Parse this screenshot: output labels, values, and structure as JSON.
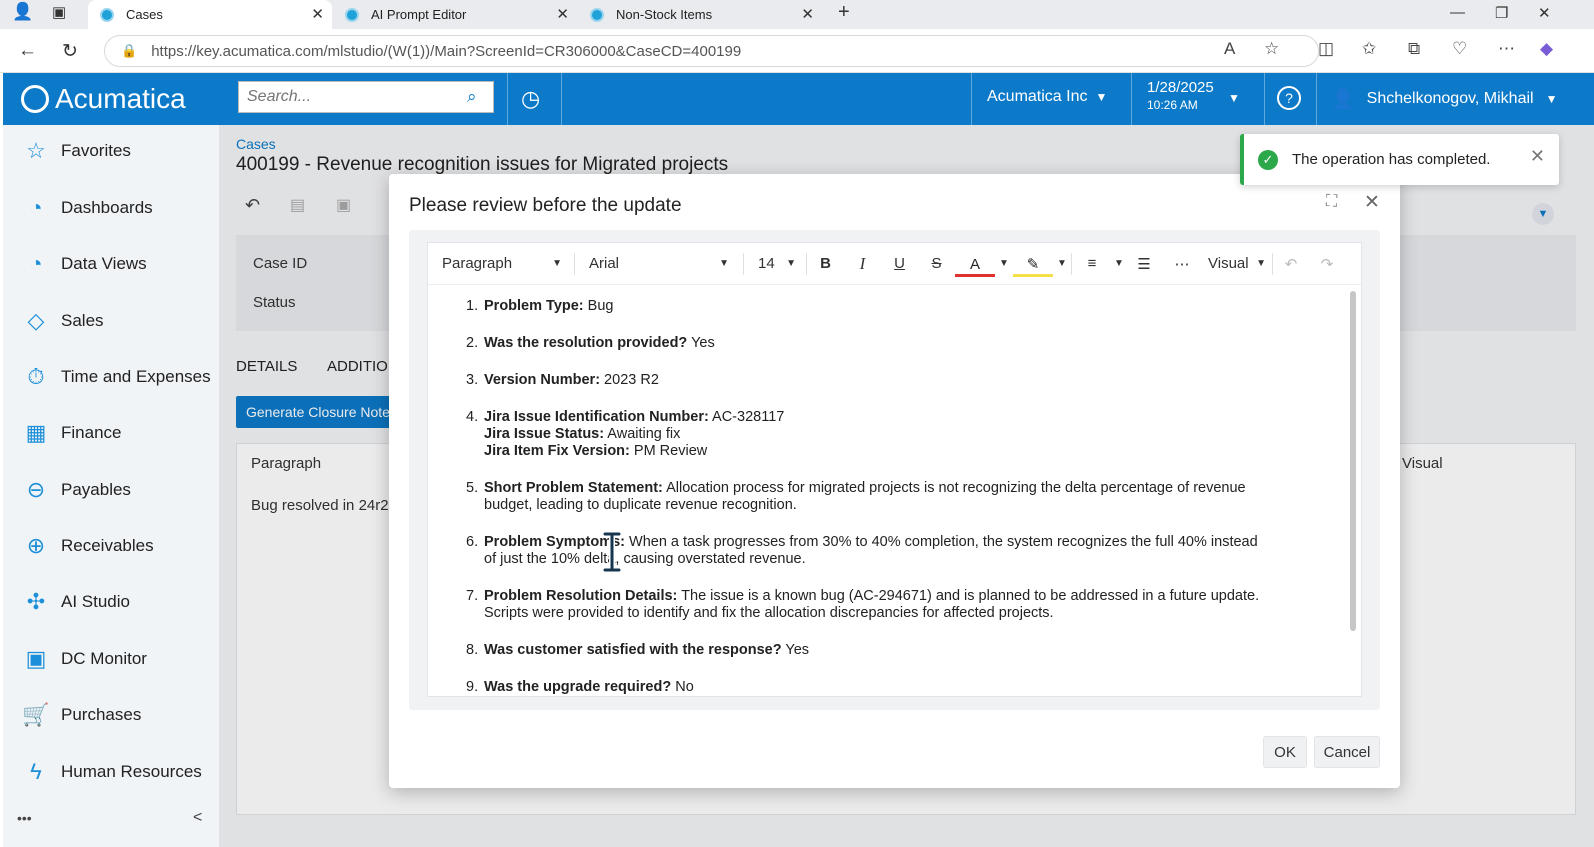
{
  "browser": {
    "tabs": [
      {
        "label": "Cases",
        "active": true
      },
      {
        "label": "AI Prompt Editor",
        "active": false
      },
      {
        "label": "Non-Stock Items",
        "active": false
      }
    ],
    "url": "https://key.acumatica.com/mlstudio/(W(1))/Main?ScreenId=CR306000&CaseCD=400199"
  },
  "header": {
    "logo": "Acumatica",
    "search_placeholder": "Search...",
    "company": "Acumatica Inc",
    "date": "1/28/2025",
    "time": "10:26 AM",
    "user": "Shchelkonogov, Mikhail"
  },
  "sidebar": {
    "items": [
      {
        "label": "Favorites",
        "icon": "star-icon"
      },
      {
        "label": "Dashboards",
        "icon": "pie-chart-icon"
      },
      {
        "label": "Data Views",
        "icon": "pie-chart-icon"
      },
      {
        "label": "Sales",
        "icon": "tag-icon"
      },
      {
        "label": "Time and Expenses",
        "icon": "stopwatch-icon"
      },
      {
        "label": "Finance",
        "icon": "calculator-icon"
      },
      {
        "label": "Payables",
        "icon": "minus-circle-icon"
      },
      {
        "label": "Receivables",
        "icon": "plus-circle-icon"
      },
      {
        "label": "AI Studio",
        "icon": "puzzle-icon"
      },
      {
        "label": "DC Monitor",
        "icon": "save-icon"
      },
      {
        "label": "Purchases",
        "icon": "cart-icon"
      },
      {
        "label": "Human Resources",
        "icon": "bolt-icon"
      }
    ],
    "more": "•••",
    "collapse": "<"
  },
  "main": {
    "breadcrumb": "Cases",
    "title": "400199 - Revenue recognition issues for Migrated projects",
    "fields": {
      "case_id": "Case ID",
      "status": "Status"
    },
    "tabs": {
      "details": "DETAILS",
      "addition": "ADDITIO"
    },
    "generate_button": "Generate Closure Note",
    "paragraph_select": "Paragraph",
    "visual_label": "Visual",
    "note_text": "Bug resolved in 24r2"
  },
  "dialog": {
    "title": "Please review before the update",
    "toolbar": {
      "block_format": "Paragraph",
      "font": "Arial",
      "size": "14",
      "mode": "Visual"
    },
    "ok": "OK",
    "cancel": "Cancel",
    "items": [
      {
        "num": "1.",
        "lines": [
          {
            "label": "Problem Type:",
            "text": " Bug"
          }
        ]
      },
      {
        "num": "2.",
        "lines": [
          {
            "label": "Was the resolution provided?",
            "text": " Yes"
          }
        ]
      },
      {
        "num": "3.",
        "lines": [
          {
            "label": "Version Number:",
            "text": " 2023 R2"
          }
        ]
      },
      {
        "num": "4.",
        "lines": [
          {
            "label": "Jira Issue Identification Number:",
            "text": " AC-328117"
          },
          {
            "label": "Jira Issue Status:",
            "text": " Awaiting fix"
          },
          {
            "label": "Jira Item Fix Version:",
            "text": " PM Review"
          }
        ]
      },
      {
        "num": "5.",
        "lines": [
          {
            "label": "Short Problem Statement:",
            "text": " Allocation process for migrated projects is not recognizing the delta percentage of revenue budget, leading to duplicate revenue recognition."
          }
        ]
      },
      {
        "num": "6.",
        "lines": [
          {
            "label": "Problem Symptoms:",
            "text": " When a task progresses from 30% to 40% completion, the system recognizes the full 40% instead of just the 10% delta, causing overstated revenue."
          }
        ]
      },
      {
        "num": "7.",
        "lines": [
          {
            "label": "Problem Resolution Details:",
            "text": " The issue is a known bug (AC-294671) and is planned to be addressed in a future update. Scripts were provided to identify and fix the allocation discrepancies for affected projects."
          }
        ]
      },
      {
        "num": "8.",
        "lines": [
          {
            "label": "Was customer satisfied with the response?",
            "text": " Yes"
          }
        ]
      },
      {
        "num": "9.",
        "lines": [
          {
            "label": "Was the upgrade required?",
            "text": " No"
          }
        ]
      }
    ]
  },
  "toast": {
    "message": "The operation has completed."
  },
  "colors": {
    "brand": "#0c7ac9",
    "success": "#2aa84a"
  }
}
